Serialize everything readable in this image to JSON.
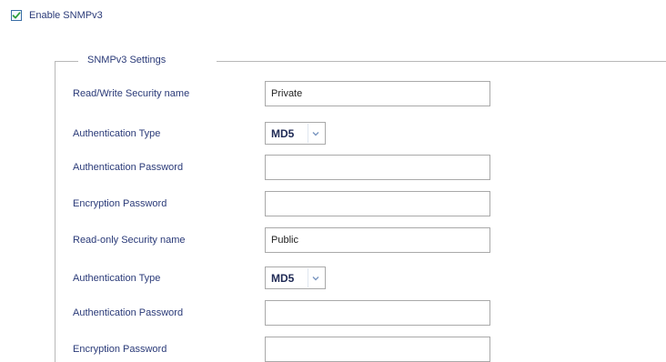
{
  "enable": {
    "checked": true,
    "label": "Enable SNMPv3"
  },
  "settings": {
    "legend": "SNMPv3 Settings",
    "rows": [
      {
        "label": "Read/Write Security name",
        "type": "text",
        "value": "Private"
      },
      {
        "label": "Authentication Type",
        "type": "select",
        "value": "MD5"
      },
      {
        "label": "Authentication Password",
        "type": "password",
        "value": ""
      },
      {
        "label": "Encryption Password",
        "type": "password",
        "value": ""
      },
      {
        "label": "Read-only Security name",
        "type": "text",
        "value": "Public"
      },
      {
        "label": "Authentication Type",
        "type": "select",
        "value": "MD5"
      },
      {
        "label": "Authentication Password",
        "type": "password",
        "value": ""
      },
      {
        "label": "Encryption Password",
        "type": "password",
        "value": ""
      }
    ]
  },
  "icons": {
    "checkbox": "checkmark-icon",
    "select_arrow": "chevron-down-icon"
  },
  "colors": {
    "label_text": "#2a3a78",
    "checkbox_border": "#3a6ea5",
    "checkmark": "#2e9e3a",
    "fieldset_border": "#b8b8b8"
  }
}
